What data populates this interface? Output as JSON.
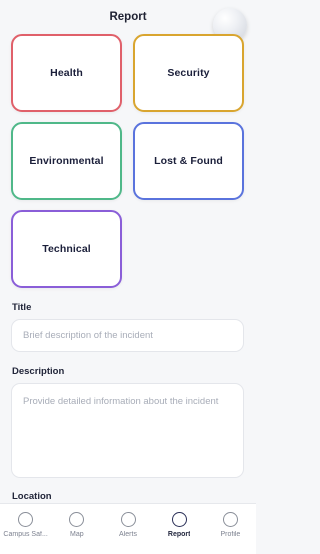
{
  "header": {
    "title": "Report"
  },
  "categories": [
    {
      "label": "Health",
      "color": "#e0606a"
    },
    {
      "label": "Security",
      "color": "#d9a52f"
    },
    {
      "label": "Environmental",
      "color": "#4fb889"
    },
    {
      "label": "Lost & Found",
      "color": "#5a73dd"
    },
    {
      "label": "Technical",
      "color": "#8a5ed8"
    }
  ],
  "form": {
    "title_label": "Title",
    "title_placeholder": "Brief description of the incident",
    "description_label": "Description",
    "description_placeholder": "Provide detailed information about the incident",
    "location_label": "Location"
  },
  "tabs": [
    {
      "label": "Campus Saf...",
      "icon": "circle-icon",
      "active": false
    },
    {
      "label": "Map",
      "icon": "circle-icon",
      "active": false
    },
    {
      "label": "Alerts",
      "icon": "circle-icon",
      "active": false
    },
    {
      "label": "Report",
      "icon": "circle-icon",
      "active": true
    },
    {
      "label": "Profile",
      "icon": "circle-icon",
      "active": false
    }
  ]
}
